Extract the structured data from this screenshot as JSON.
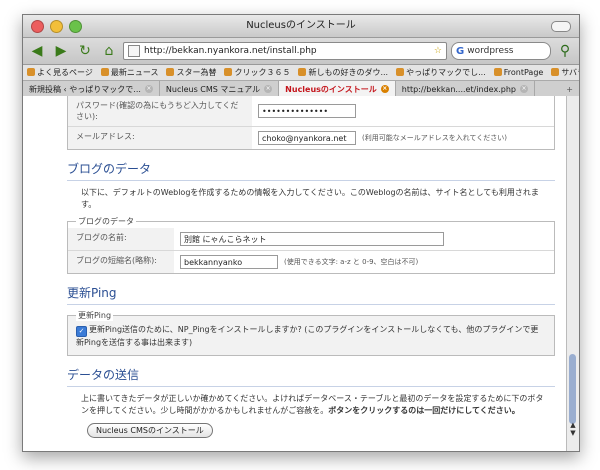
{
  "window": {
    "title": "Nucleusのインストール"
  },
  "toolbar": {
    "url": "http://bekkan.nyankora.net/install.php",
    "search_value": "wordpress"
  },
  "bookmarks": [
    "よく見るページ",
    "最新ニュース",
    "スター為替",
    "クリック３６５",
    "新しもの好きのダウ...",
    "やっぱりマックでし...",
    "FrontPage",
    "サバラの日記"
  ],
  "tabs": [
    {
      "label": "新規投稿 ‹ やっぱりマックで...",
      "active": false
    },
    {
      "label": "Nucleus CMS マニュアル",
      "active": false
    },
    {
      "label": "Nucleusのインストール",
      "active": true
    },
    {
      "label": "http://bekkan....et/index.php",
      "active": false
    }
  ],
  "account_section": {
    "password_confirm_label": "パスワード(確認の為にもうちど入力してください):",
    "password_value": "••••••••••••••",
    "email_label": "メールアドレス:",
    "email_value": "choko@nyankora.net",
    "email_hint": "(利用可能なメールアドレスを入れてください)"
  },
  "blog_section": {
    "heading": "ブログのデータ",
    "intro": "以下に、デフォルトのWeblogを作成するための情報を入力してください。このWeblogの名前は、サイト名としても利用されます。",
    "legend": "ブログのデータ",
    "name_label": "ブログの名前:",
    "name_value": "別館 にゃんこらネット",
    "short_label": "ブログの短縮名(略称):",
    "short_value": "bekkannyanko",
    "short_hint": "(使用できる文字: a-z と 0-9、空白は不可)"
  },
  "ping_section": {
    "heading": "更新Ping",
    "legend": "更新Ping",
    "checkbox_text": "更新Ping送信のために、NP_Pingをインストールしますか? (このプラグインをインストールしなくても、他のプラグインで更新Pingを送信する事は出来ます)",
    "checked": true
  },
  "submit_section": {
    "heading": "データの送信",
    "text": "上に書いてきたデータが正しいか確かめてください。よければデータベース・テーブルと最初のデータを設定するために下のボタンを押してください。少し時間がかかるかもしれませんがご容赦を。",
    "bold_text": "ボタンをクリックするのは一回だけにしてください。",
    "button_label": "Nucleus CMSのインストール"
  },
  "colors": {
    "heading": "#2b4f93",
    "active_tab": "#c4151c"
  }
}
